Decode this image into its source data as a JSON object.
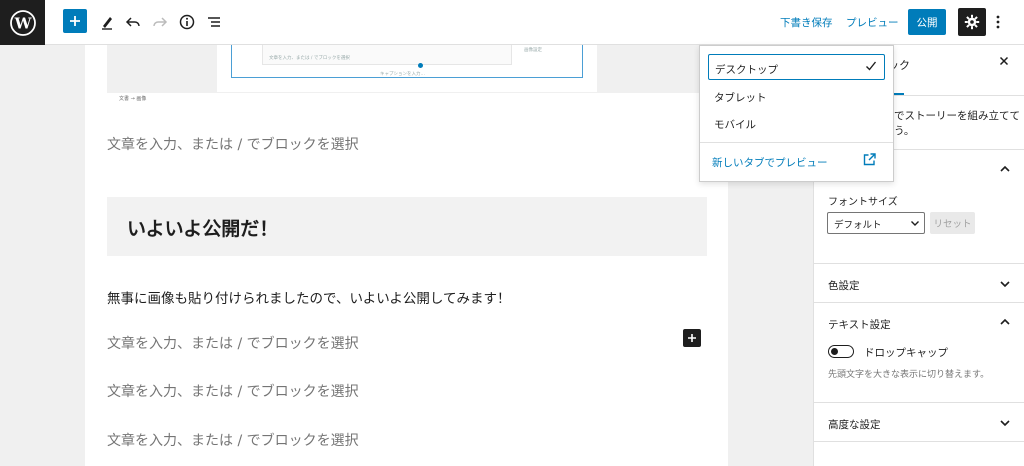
{
  "topbar": {
    "save_draft": "下書き保存",
    "preview": "プレビュー",
    "publish": "公開"
  },
  "editor": {
    "image_block": {
      "placeholder_small": "文章を入力、または / でブロックを選択",
      "caption_placeholder": "キャプションを入力…",
      "side_label": "画像設定",
      "breadcrumb": "文書 → 画像"
    },
    "placeholder_text": "文章を入力、または / でブロックを選択",
    "heading": "いよいよ公開だ！",
    "paragraph": "無事に画像も貼り付けられましたので、いよいよ公開してみます！"
  },
  "preview_menu": {
    "items": [
      {
        "label": "デスクトップ",
        "selected": true
      },
      {
        "label": "タブレット",
        "selected": false
      },
      {
        "label": "モバイル",
        "selected": false
      }
    ],
    "new_tab_link": "新しいタブでプレビュー"
  },
  "sidebar": {
    "tab_label_partial": "ック",
    "description_partial": [
      "でストーリーを組み立てて",
      "う。"
    ],
    "font_size_label": "フォントサイズ",
    "font_size_value": "デフォルト",
    "reset": "リセット",
    "color_settings": "色設定",
    "text_settings": "テキスト設定",
    "drop_cap": "ドロップキャップ",
    "drop_cap_help": "先頭文字を大きな表示に切り替えます。",
    "advanced": "高度な設定"
  },
  "colors": {
    "accent": "#007cba",
    "dark": "#1e1e1e"
  }
}
